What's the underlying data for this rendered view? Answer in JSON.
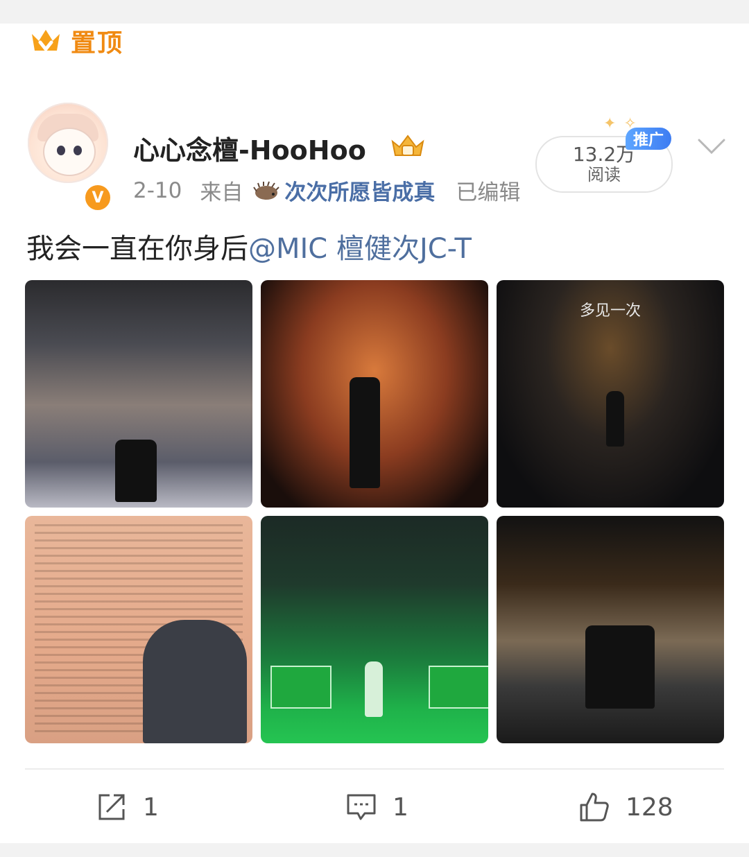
{
  "pinned": {
    "label": "置顶"
  },
  "post": {
    "username": "心心念檀-HooHoo",
    "date": "2-10",
    "from_label": "来自",
    "source": "次次所愿皆成真",
    "edited": "已编辑",
    "reads": {
      "count": "13.2万",
      "label": "阅读"
    },
    "promo_badge": "推广",
    "text": "我会一直在你身后",
    "mention": "@MIC 檀健次JC-T",
    "images": [
      {
        "name": "fan-meeting-photo"
      },
      {
        "name": "concert-crowd-photo"
      },
      {
        "name": "concert-stage-photo",
        "overlay_text": "多见一次"
      },
      {
        "name": "signature-wall-photo"
      },
      {
        "name": "green-stage-photo"
      },
      {
        "name": "theater-group-photo"
      }
    ]
  },
  "actions": {
    "share_count": "1",
    "comment_count": "1",
    "like_count": "128"
  },
  "colors": {
    "accent_orange": "#f08a12",
    "mention_blue": "#4f6f9e",
    "promo_blue": "#3d7cf2"
  }
}
